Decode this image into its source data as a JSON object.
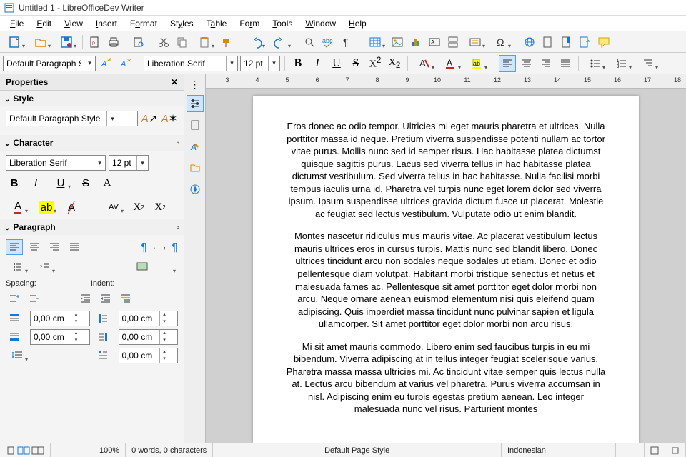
{
  "window": {
    "title": "Untitled 1 - LibreOfficeDev Writer"
  },
  "menu": {
    "file": "File",
    "edit": "Edit",
    "view": "View",
    "insert": "Insert",
    "format": "Format",
    "styles": "Styles",
    "table": "Table",
    "form": "Form",
    "tools": "Tools",
    "window": "Window",
    "help": "Help"
  },
  "fmt": {
    "para_style": "Default Paragraph Style",
    "font_name": "Liberation Serif",
    "font_size": "12 pt"
  },
  "sidebar": {
    "title": "Properties",
    "style": {
      "label": "Style",
      "value": "Default Paragraph Style"
    },
    "character": {
      "label": "Character",
      "font": "Liberation Serif",
      "size": "12 pt"
    },
    "paragraph": {
      "label": "Paragraph",
      "spacing_label": "Spacing:",
      "indent_label": "Indent:",
      "space_above": "0,00 cm",
      "space_below": "0,00 cm",
      "indent_left": "0,00 cm",
      "indent_right": "0,00 cm",
      "indent_first": "0,00 cm"
    }
  },
  "ruler": {
    "ticks": [
      "3",
      "4",
      "5",
      "6",
      "7",
      "8",
      "9",
      "10",
      "11",
      "12",
      "13",
      "14",
      "15",
      "16",
      "17",
      "18"
    ]
  },
  "document": {
    "p1": "Eros donec ac odio tempor. Ultricies mi eget mauris pharetra et ultrices. Nulla porttitor massa id neque. Pretium viverra suspendisse potenti nullam ac tortor vitae purus. Mollis nunc sed id semper risus. Hac habitasse platea dictumst quisque sagittis purus. Lacus sed viverra tellus in hac habitasse platea dictumst vestibulum. Sed viverra tellus in hac habitasse. Nulla facilisi morbi tempus iaculis urna id. Pharetra vel turpis nunc eget lorem dolor sed viverra ipsum. Ipsum suspendisse ultrices gravida dictum fusce ut placerat. Molestie ac feugiat sed lectus vestibulum. Vulputate odio ut enim blandit.",
    "p2": "Montes nascetur ridiculus mus mauris vitae. Ac placerat vestibulum lectus mauris ultrices eros in cursus turpis. Mattis nunc sed blandit libero. Donec ultrices tincidunt arcu non sodales neque sodales ut etiam. Donec et odio pellentesque diam volutpat. Habitant morbi tristique senectus et netus et malesuada fames ac. Pellentesque sit amet porttitor eget dolor morbi non arcu. Neque ornare aenean euismod elementum nisi quis eleifend quam adipiscing. Quis imperdiet massa tincidunt nunc pulvinar sapien et ligula ullamcorper. Sit amet porttitor eget dolor morbi non arcu risus.",
    "p3": "Mi sit amet mauris commodo. Libero enim sed faucibus turpis in eu mi bibendum. Viverra adipiscing at in tellus integer feugiat scelerisque varius. Pharetra massa massa ultricies mi. Ac tincidunt vitae semper quis lectus nulla at. Lectus arcu bibendum at varius vel pharetra. Purus viverra accumsan in nisl. Adipiscing enim eu turpis egestas pretium aenean. Leo integer malesuada nunc vel risus. Parturient montes"
  },
  "status": {
    "zoom": "100%",
    "words": "0 words, 0 characters",
    "pagestyle": "Default Page Style",
    "lang": "Indonesian"
  }
}
